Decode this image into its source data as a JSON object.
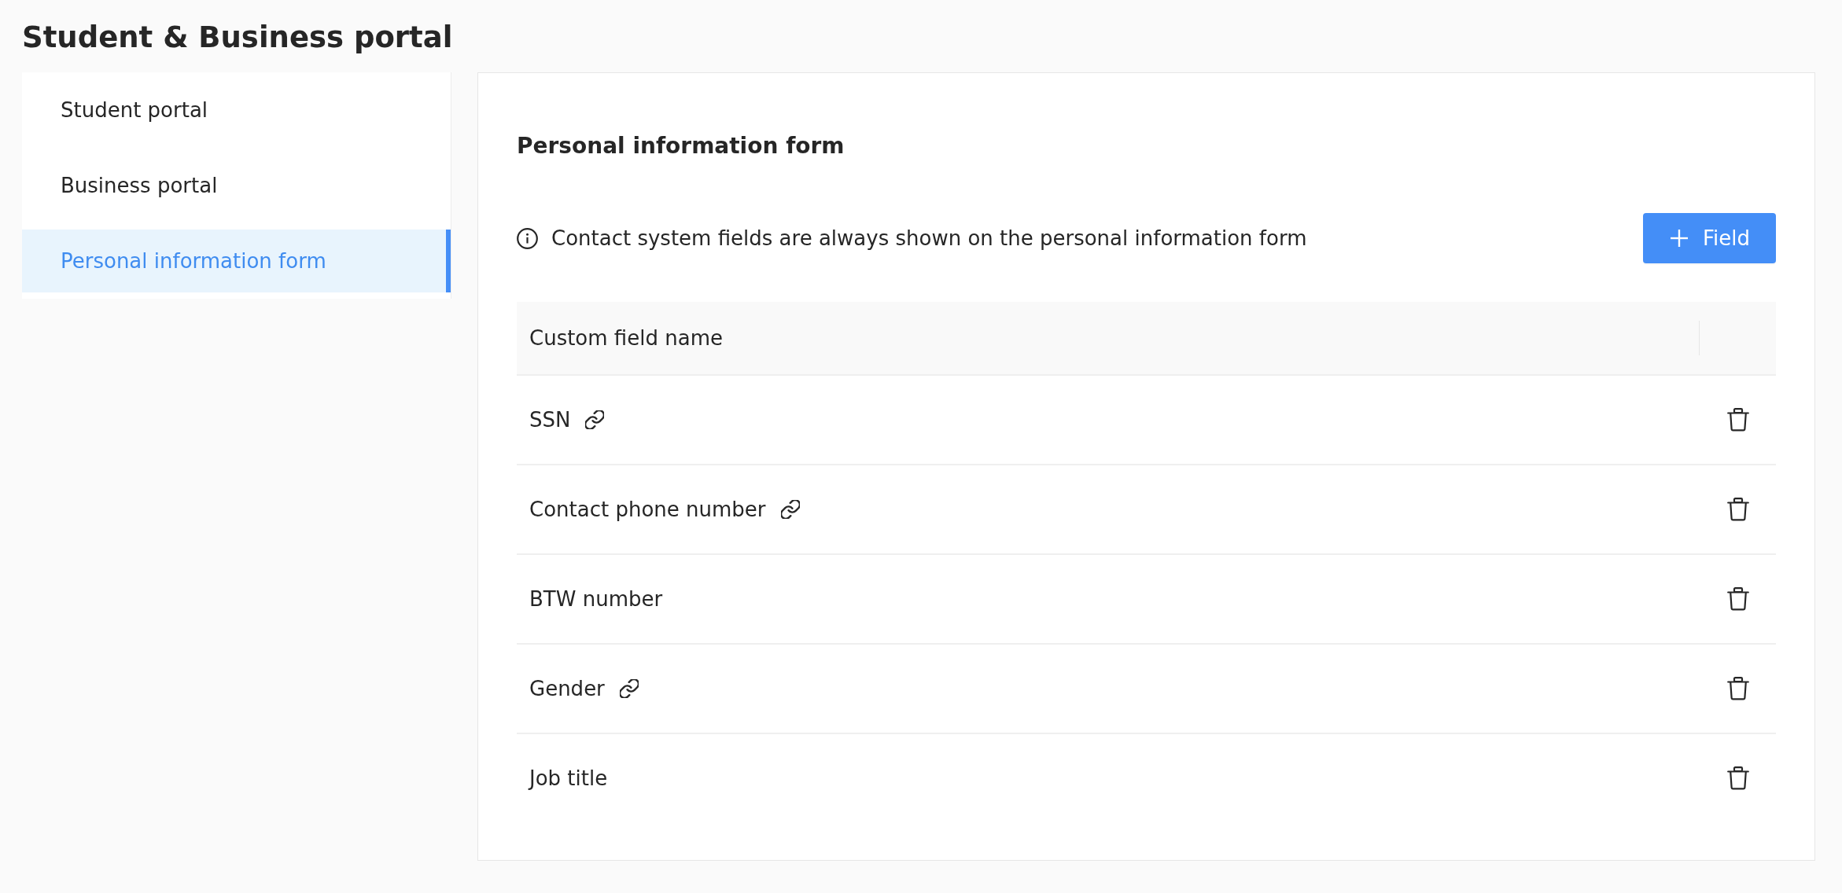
{
  "page": {
    "title": "Student & Business portal"
  },
  "sidebar": {
    "items": [
      {
        "label": "Student portal",
        "selected": false
      },
      {
        "label": "Business portal",
        "selected": false
      },
      {
        "label": "Personal information form",
        "selected": true
      }
    ]
  },
  "panel": {
    "heading": "Personal information form",
    "notice": "Contact system fields are always shown on the personal information form",
    "add_button": {
      "label": "Field"
    }
  },
  "table": {
    "columns": [
      "Custom field name"
    ],
    "rows": [
      {
        "name": "SSN",
        "linked": true
      },
      {
        "name": "Contact phone number",
        "linked": true
      },
      {
        "name": "BTW number",
        "linked": false
      },
      {
        "name": "Gender",
        "linked": true
      },
      {
        "name": "Job title",
        "linked": false
      }
    ]
  }
}
